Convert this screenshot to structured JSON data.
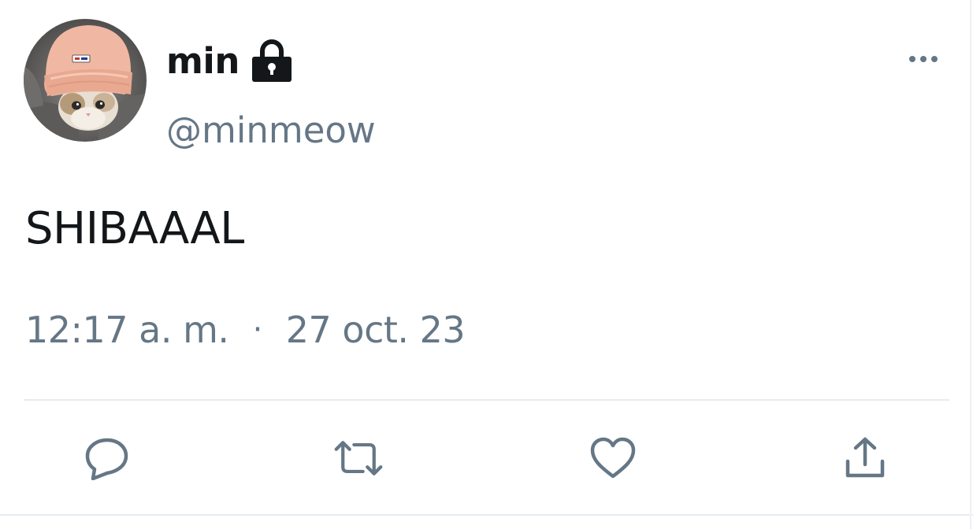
{
  "user": {
    "display_name": "min",
    "handle": "@minmeow",
    "avatar_icon": "cat-in-beanie-avatar",
    "protected_icon": "lock-icon"
  },
  "tweet": {
    "text": "SHIBAAAL",
    "time": "12:17 a. m.",
    "separator": "·",
    "date": "27 oct. 23"
  },
  "actions": [
    {
      "icon": "reply-icon"
    },
    {
      "icon": "retweet-icon"
    },
    {
      "icon": "like-icon"
    },
    {
      "icon": "share-icon"
    }
  ],
  "menu": {
    "icon": "more-options-icon"
  },
  "colors": {
    "primary_text": "#14171a",
    "secondary_text": "#657786",
    "icon_gray": "#657786",
    "divider": "#e6ecf0"
  }
}
